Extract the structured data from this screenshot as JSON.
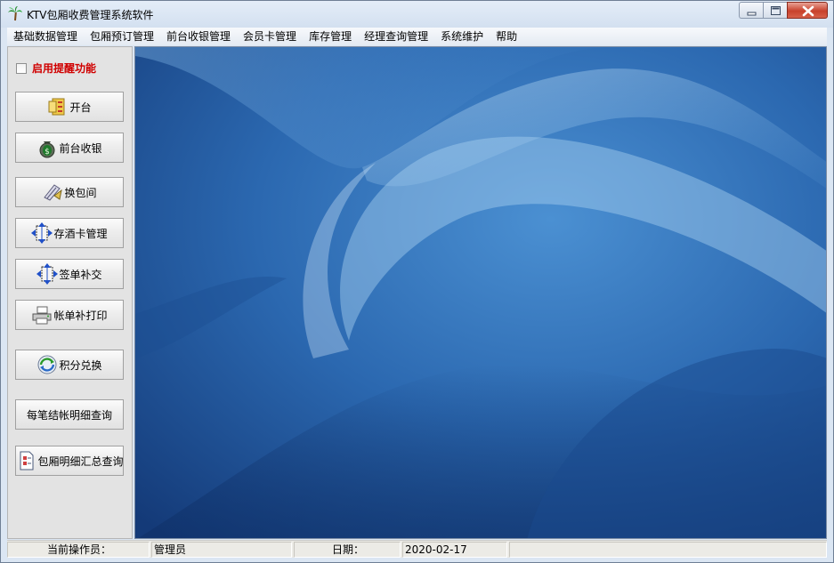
{
  "window": {
    "title": "KTV包厢收费管理系统软件",
    "icon": "palm-tree-icon"
  },
  "menu": [
    "基础数据管理",
    "包厢预订管理",
    "前台收银管理",
    "会员卡管理",
    "库存管理",
    "经理查询管理",
    "系统维护",
    "帮助"
  ],
  "sidebar": {
    "remind_label": "启用提醒功能",
    "remind_checked": false,
    "buttons": [
      {
        "label": "开台",
        "icon": "open-table-icon"
      },
      {
        "label": "前台收银",
        "icon": "money-bag-icon"
      },
      {
        "label": "换包间",
        "icon": "swap-room-icon"
      },
      {
        "label": "存酒卡管理",
        "icon": "wine-card-icon"
      },
      {
        "label": "签单补交",
        "icon": "sign-bill-icon"
      },
      {
        "label": "帐单补打印",
        "icon": "printer-icon"
      },
      {
        "label": "积分兑换",
        "icon": "points-exchange-icon"
      },
      {
        "label": "每笔结帐明细查询",
        "icon": ""
      },
      {
        "label": "包厢明细汇总查询",
        "icon": "report-icon"
      }
    ]
  },
  "status": {
    "operator_label": "当前操作员：",
    "operator_value": "管理员",
    "date_label": "日期：",
    "date_value": "2020-02-17"
  },
  "colors": {
    "accent_red": "#d00000",
    "wallpaper_blue": "#2d6db4"
  }
}
